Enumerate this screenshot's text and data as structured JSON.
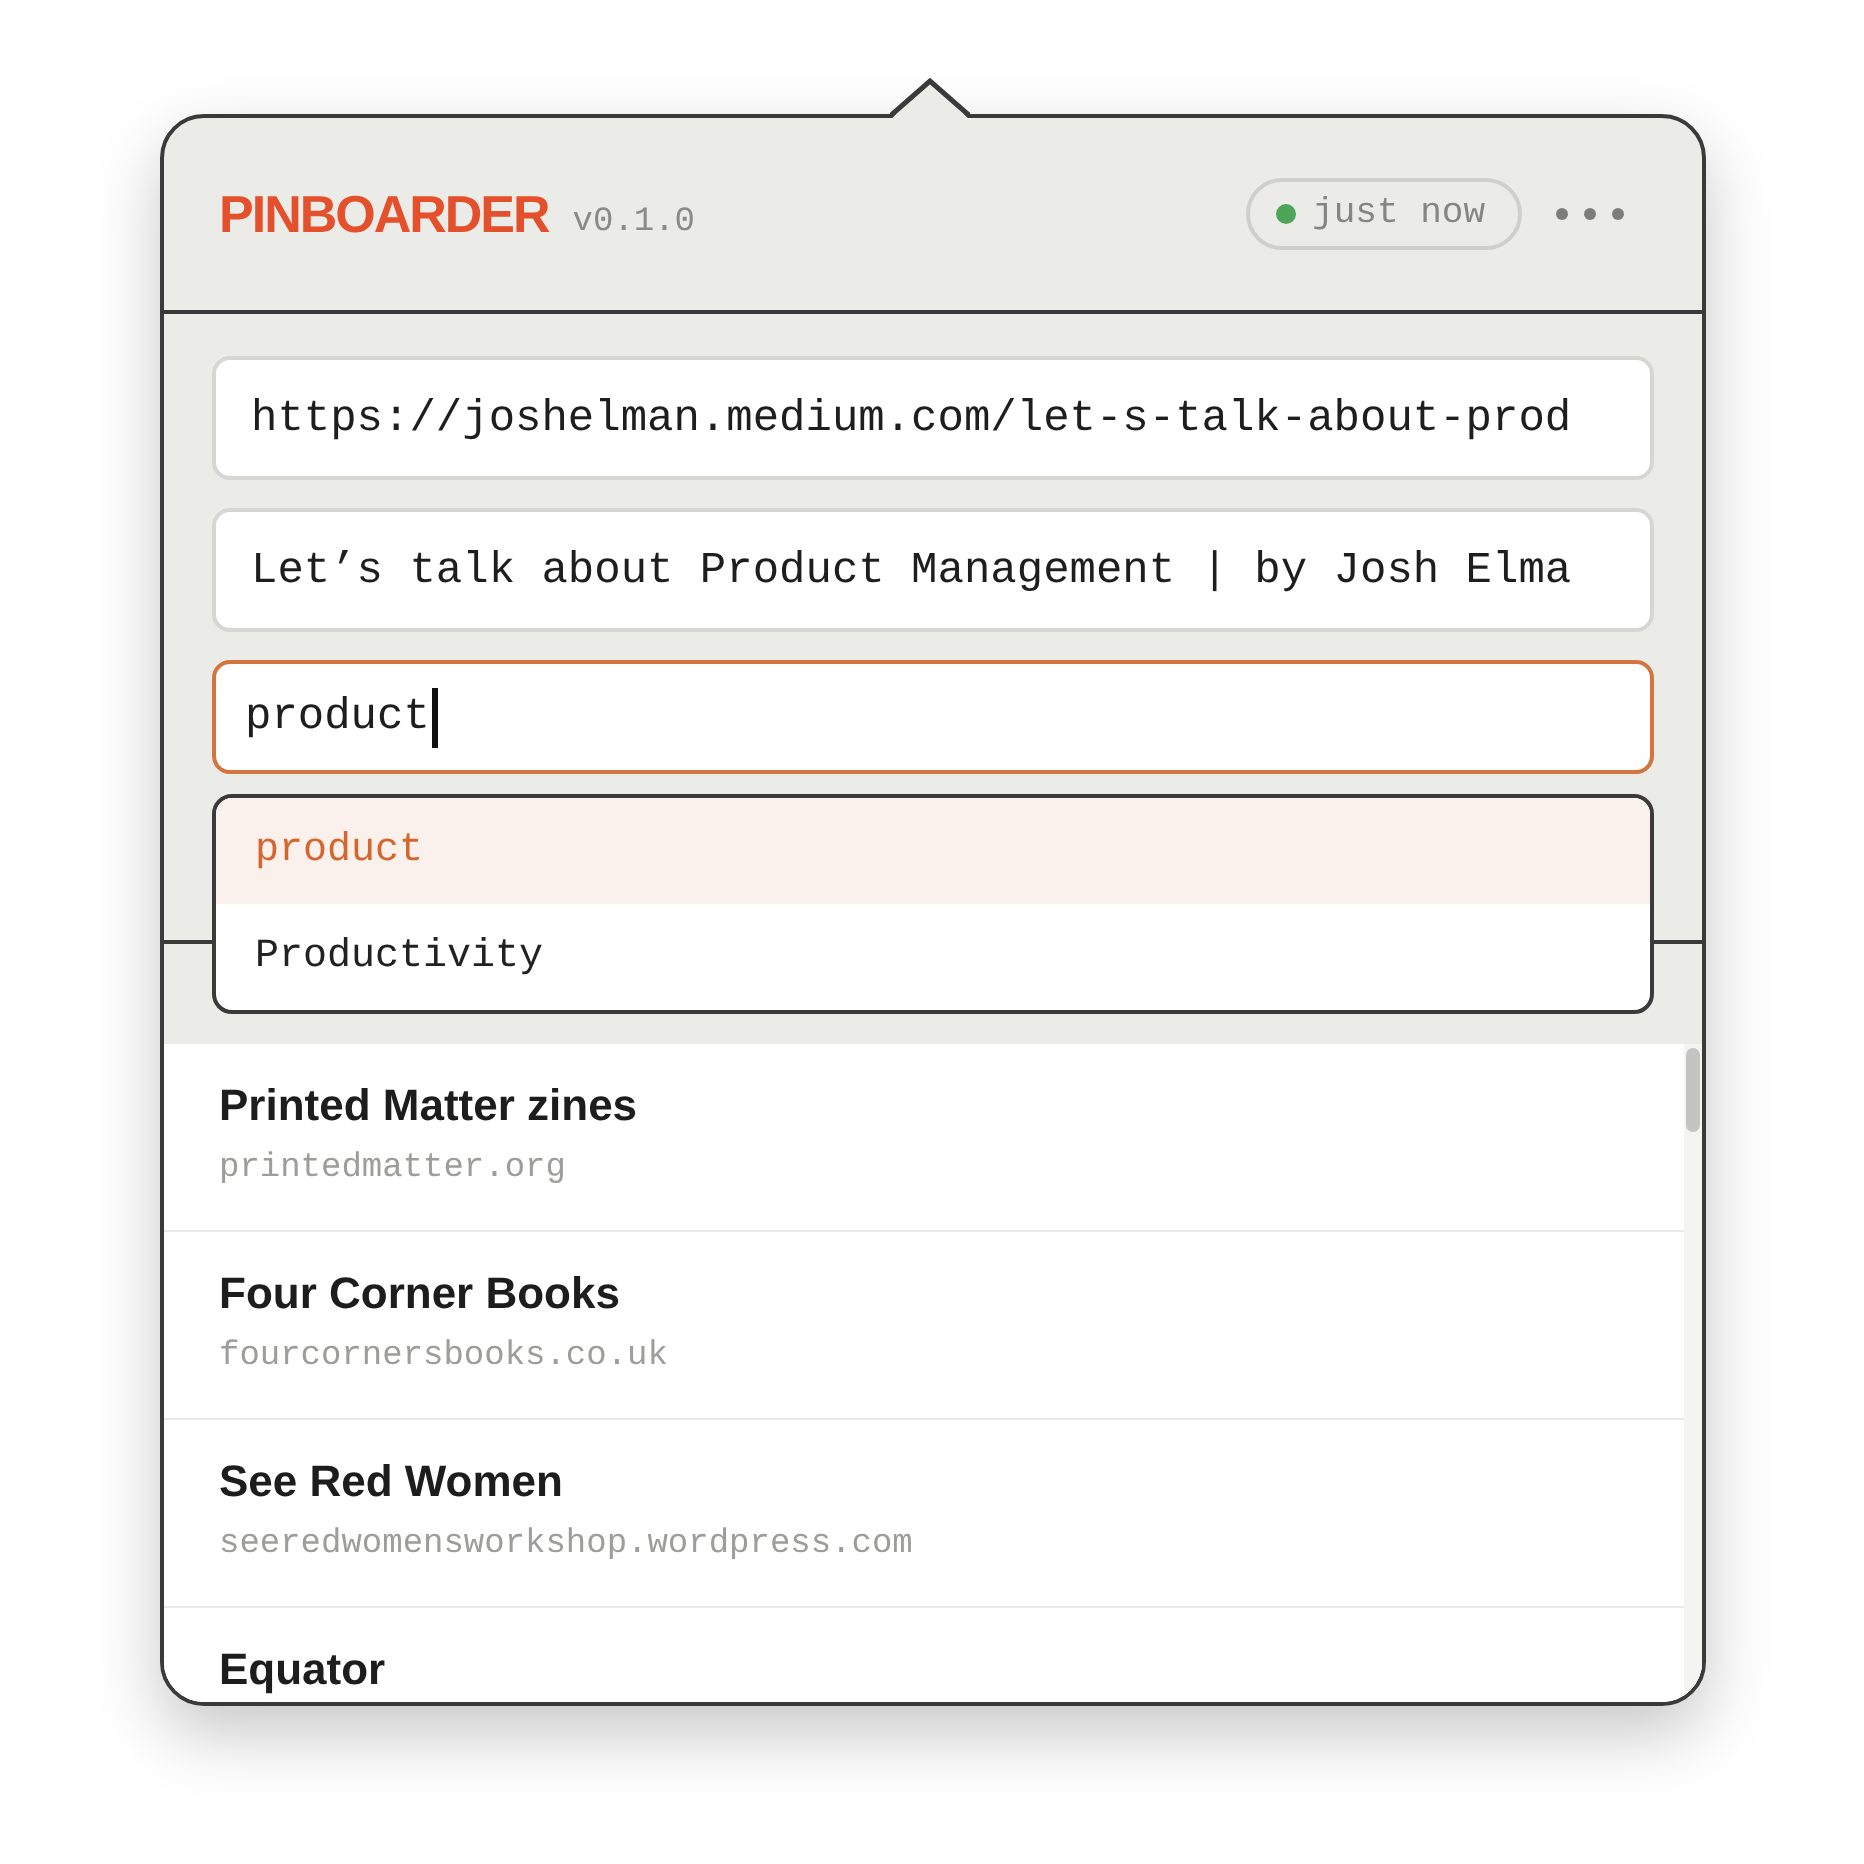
{
  "app": {
    "name": "PINBOARDER",
    "version": "v0.1.0"
  },
  "sync_status": {
    "label": "just now",
    "online": true
  },
  "form": {
    "url": {
      "value": "https://joshelman.medium.com/let-s-talk-about-prod"
    },
    "title": {
      "value": "Let’s talk about Product Management | by Josh Elma"
    },
    "tags": {
      "value": "product",
      "focused": true
    }
  },
  "suggestions": [
    {
      "label": "product",
      "selected": true
    },
    {
      "label": "Productivity",
      "selected": false
    }
  ],
  "bookmarks": [
    {
      "title": "Printed Matter zines",
      "url": "printedmatter.org"
    },
    {
      "title": "Four Corner Books",
      "url": "fourcornersbooks.co.uk"
    },
    {
      "title": "See Red Women",
      "url": "seeredwomensworkshop.wordpress.com"
    },
    {
      "title": "Equator"
    }
  ]
}
